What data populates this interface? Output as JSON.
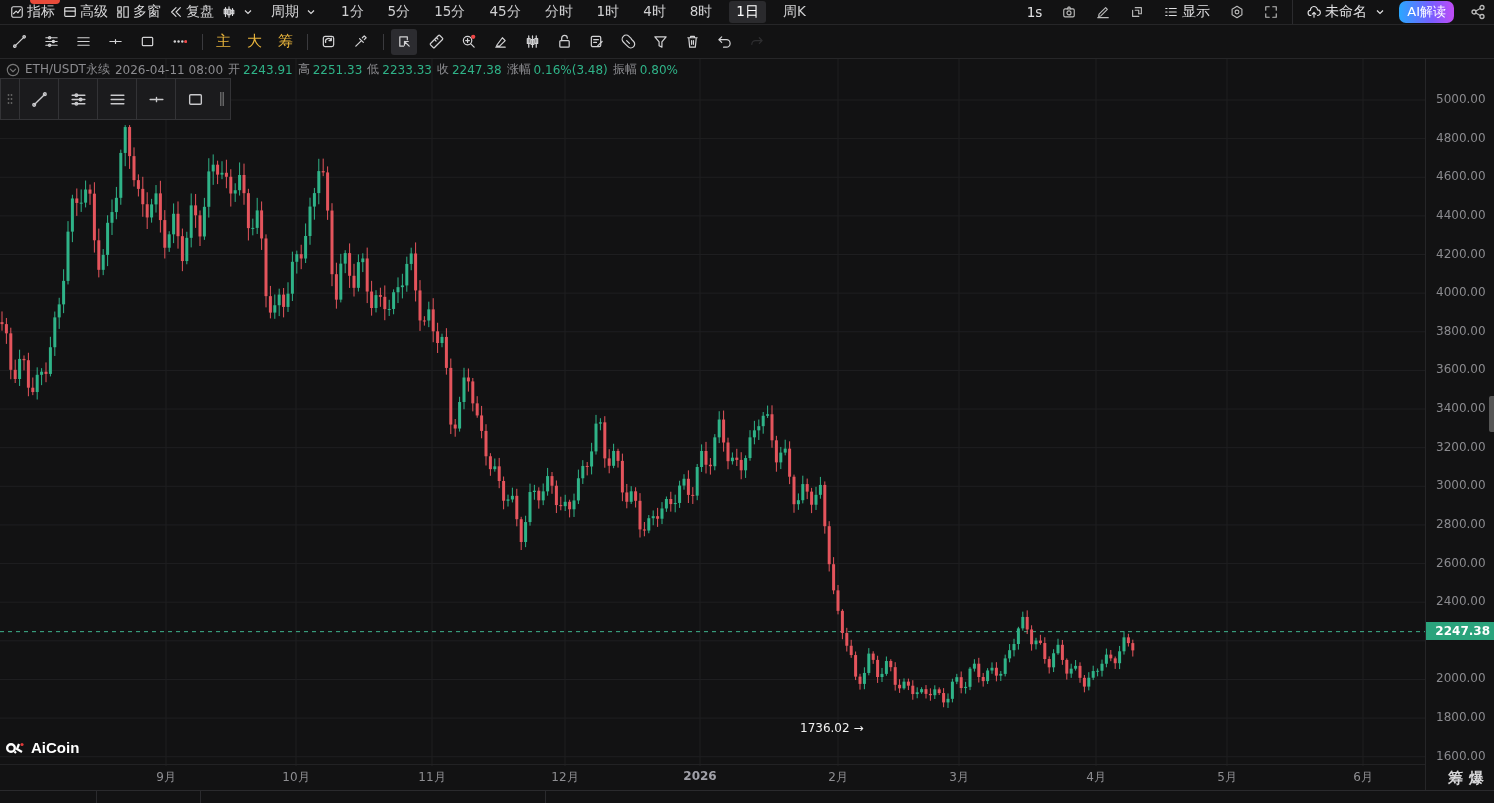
{
  "top_bar": {
    "menu_items": [
      {
        "label": "指标",
        "badge": true
      },
      {
        "label": "高级",
        "badge": false
      },
      {
        "label": "多窗",
        "badge": false
      },
      {
        "label": "复盘",
        "badge": false
      }
    ],
    "period_menu": {
      "label": "周期"
    },
    "periods": [
      {
        "label": "1分",
        "selected": false
      },
      {
        "label": "5分",
        "selected": false
      },
      {
        "label": "15分",
        "selected": false
      },
      {
        "label": "45分",
        "selected": false
      },
      {
        "label": "分时",
        "selected": false
      },
      {
        "label": "1时",
        "selected": false
      },
      {
        "label": "4时",
        "selected": false
      },
      {
        "label": "8时",
        "selected": false
      },
      {
        "label": "1日",
        "selected": true
      },
      {
        "label": "周K",
        "selected": false
      }
    ],
    "interval": "1s",
    "display_label": "显示",
    "layout_name": "未命名",
    "ai_button": "AI解读"
  },
  "drawing_toolbar": {
    "tools": [
      {
        "kind": "icon",
        "selected": false,
        "disabled": false
      },
      {
        "kind": "icon",
        "selected": false,
        "disabled": false
      },
      {
        "kind": "icon",
        "selected": false,
        "disabled": false
      },
      {
        "kind": "icon",
        "selected": false,
        "disabled": false
      },
      {
        "kind": "icon",
        "selected": false,
        "disabled": false
      },
      {
        "kind": "icon",
        "selected": false,
        "disabled": false
      },
      {
        "kind": "text",
        "label": "主",
        "selected": false
      },
      {
        "kind": "text",
        "label": "大",
        "selected": false
      },
      {
        "kind": "text",
        "label": "筹",
        "selected": false
      },
      {
        "kind": "icon",
        "selected": false,
        "disabled": false
      },
      {
        "kind": "icon",
        "selected": false,
        "disabled": false
      },
      {
        "kind": "icon",
        "selected": true,
        "disabled": false
      },
      {
        "kind": "icon",
        "selected": false,
        "disabled": false
      },
      {
        "kind": "icon",
        "selected": false,
        "disabled": false
      },
      {
        "kind": "icon",
        "selected": false,
        "disabled": false
      },
      {
        "kind": "icon",
        "selected": false,
        "disabled": false
      },
      {
        "kind": "icon",
        "selected": false,
        "disabled": false
      },
      {
        "kind": "icon",
        "selected": false,
        "disabled": false
      },
      {
        "kind": "icon",
        "selected": false,
        "disabled": false
      },
      {
        "kind": "icon",
        "selected": false,
        "disabled": false
      },
      {
        "kind": "icon",
        "selected": false,
        "disabled": false
      },
      {
        "kind": "icon",
        "selected": false,
        "disabled": false
      },
      {
        "kind": "icon",
        "selected": false,
        "disabled": true
      }
    ]
  },
  "info_line": {
    "symbol": "ETH/USDT永续",
    "datetime": "2026-04-11 08:00",
    "fields": [
      {
        "label": "开",
        "value": "2243.91"
      },
      {
        "label": "高",
        "value": "2251.33"
      },
      {
        "label": "低",
        "value": "2233.33"
      },
      {
        "label": "收",
        "value": "2247.38"
      },
      {
        "label": "涨幅",
        "value": "0.16%(3.48)"
      },
      {
        "label": "振幅",
        "value": "0.80%"
      }
    ]
  },
  "chart": {
    "price_ticks": [
      "5000.00",
      "4800.00",
      "4600.00",
      "4400.00",
      "4200.00",
      "4000.00",
      "3800.00",
      "3600.00",
      "3400.00",
      "3200.00",
      "3000.00",
      "2800.00",
      "2600.00",
      "2400.00",
      "2000.00",
      "1800.00",
      "1600.00"
    ],
    "time_ticks": [
      {
        "label": "9月",
        "bold": false
      },
      {
        "label": "10月",
        "bold": false
      },
      {
        "label": "11月",
        "bold": false
      },
      {
        "label": "12月",
        "bold": false
      },
      {
        "label": "2026",
        "bold": true
      },
      {
        "label": "2月",
        "bold": false
      },
      {
        "label": "3月",
        "bold": false
      },
      {
        "label": "4月",
        "bold": false
      },
      {
        "label": "5月",
        "bold": false
      },
      {
        "label": "6月",
        "bold": false
      }
    ],
    "last_price": "2247.38",
    "low_marker": "1736.02 →",
    "logo": "AiCoin"
  },
  "corner_buttons": [
    "筹",
    "爆"
  ]
}
